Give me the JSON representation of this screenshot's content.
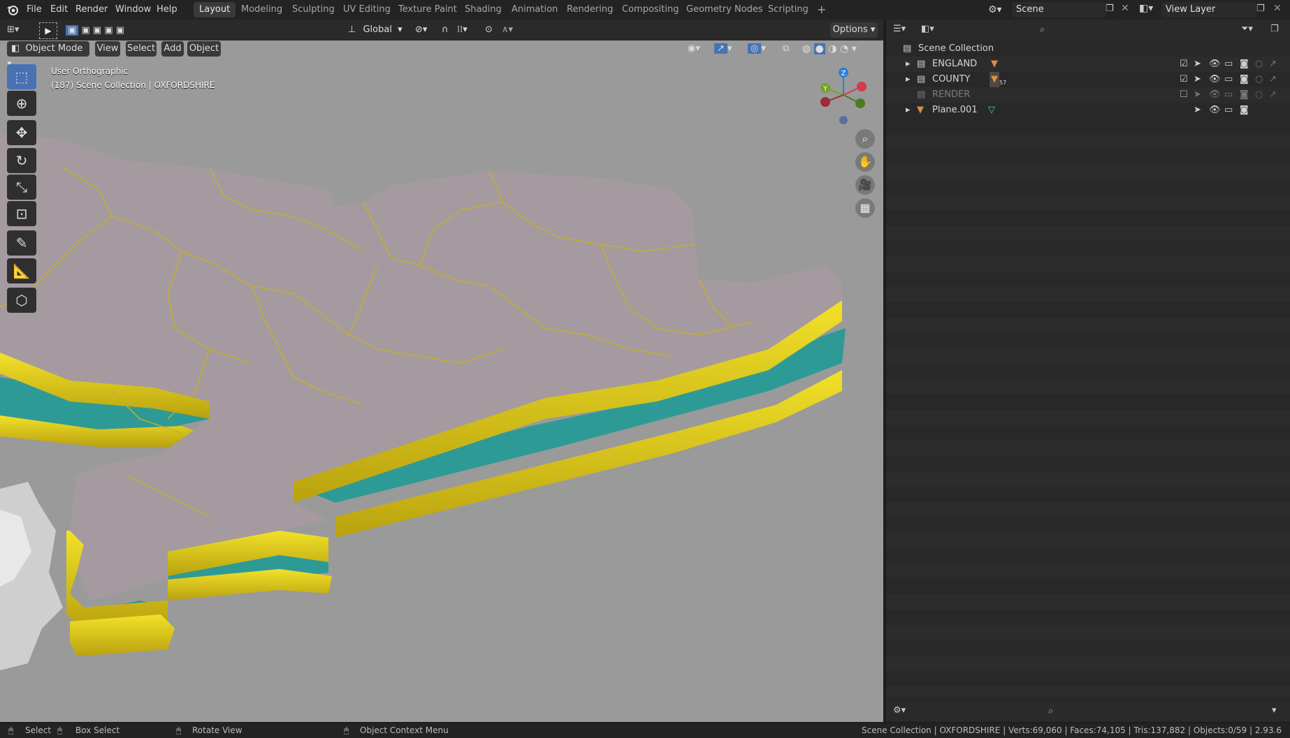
{
  "menu": [
    "File",
    "Edit",
    "Render",
    "Window",
    "Help"
  ],
  "workspaces": [
    "Layout",
    "Modeling",
    "Sculpting",
    "UV Editing",
    "Texture Paint",
    "Shading",
    "Animation",
    "Rendering",
    "Compositing",
    "Geometry Nodes",
    "Scripting"
  ],
  "active_workspace": "Layout",
  "add_workspace": "+",
  "scene": {
    "label": "Scene"
  },
  "view_layer": {
    "label": "View Layer"
  },
  "header": {
    "transform_orientation": "Global",
    "options": "Options",
    "mode": "Object Mode",
    "view": "View",
    "select": "Select",
    "add": "Add",
    "object": "Object"
  },
  "viewport": {
    "view_name": "User Orthographic",
    "context": "(187) Scene Collection | OXFORDSHIRE",
    "gizmo": {
      "z": "Z",
      "y": "Y",
      "x": "X"
    }
  },
  "outliner": {
    "root": "Scene Collection",
    "items": [
      {
        "name": "ENGLAND",
        "badge": "",
        "checked": true
      },
      {
        "name": "COUNTY",
        "badge": "57",
        "checked": true
      },
      {
        "name": "RENDER",
        "badge": "",
        "checked": false
      },
      {
        "name": "Plane.001",
        "badge": "",
        "checked": null
      }
    ]
  },
  "status": {
    "select": "Select",
    "box_select": "Box Select",
    "rotate_view": "Rotate View",
    "context_menu": "Object Context Menu",
    "stats": "Scene Collection | OXFORDSHIRE | Verts:69,060 | Faces:74,105 | Tris:137,882 | Objects:0/59 | 2.93.6"
  },
  "colors": {
    "accent": "#4772b3",
    "land": "#a59aa0",
    "edge_yellow": "#e6d41c",
    "water": "#2e9a96",
    "viewport_bg": "#9a9a9a"
  }
}
